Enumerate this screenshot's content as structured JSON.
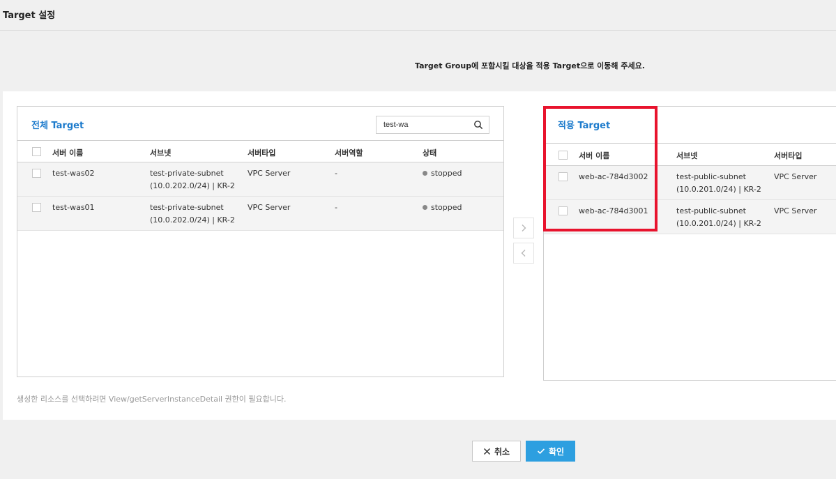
{
  "header": {
    "title": "Target 설정"
  },
  "guide_text": "Target Group에 포함시킬 대상을 적용 Target으로 이동해 주세요.",
  "left_panel": {
    "title": "전체 Target",
    "search_value": "test-wa",
    "columns": [
      "서버 이름",
      "서브넷",
      "서버타입",
      "서버역할",
      "상태"
    ],
    "rows": [
      {
        "name": "test-was02",
        "subnet1": "test-private-subnet",
        "subnet2": "(10.0.202.0/24) | KR-2",
        "type": "VPC Server",
        "role": "-",
        "status": "stopped"
      },
      {
        "name": "test-was01",
        "subnet1": "test-private-subnet",
        "subnet2": "(10.0.202.0/24) | KR-2",
        "type": "VPC Server",
        "role": "-",
        "status": "stopped"
      }
    ]
  },
  "right_panel": {
    "title": "적용 Target",
    "columns": [
      "서버 이름",
      "서브넷",
      "서버타입"
    ],
    "rows": [
      {
        "name": "web-ac-784d3002",
        "subnet1": "test-public-subnet",
        "subnet2": "(10.0.201.0/24) | KR-2",
        "type": "VPC Server"
      },
      {
        "name": "web-ac-784d3001",
        "subnet1": "test-public-subnet",
        "subnet2": "(10.0.201.0/24) | KR-2",
        "type": "VPC Server"
      }
    ]
  },
  "notice": "생성한 리소스를 선택하려면 View/getServerInstanceDetail 권한이 필요합니다.",
  "buttons": {
    "cancel": "취소",
    "ok": "확인"
  },
  "icons": {
    "search": "search-icon",
    "move_right": "chevron-right-icon",
    "move_left": "chevron-left-icon",
    "close": "close-icon",
    "check": "check-icon"
  },
  "colors": {
    "accent": "#1d7bcc",
    "primary_button": "#2d9fe0",
    "highlight": "#e8132d",
    "status_stopped": "#888888"
  }
}
